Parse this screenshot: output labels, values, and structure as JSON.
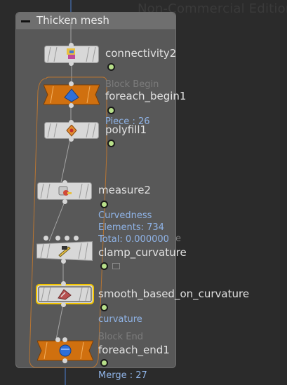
{
  "watermark": "Non-Commercial Edition",
  "network_box": {
    "title": "Thicken mesh"
  },
  "nodes": {
    "connectivity": {
      "name": "connectivity2"
    },
    "foreach_begin": {
      "name": "foreach_begin1",
      "ghost": "Block Begin",
      "info": "Piece : 26"
    },
    "polyfill": {
      "name": "polyfill1"
    },
    "measure": {
      "name": "measure2",
      "info": [
        "Curvedness",
        "Elements: 734",
        "Total: 0.000000"
      ]
    },
    "clamp": {
      "name": "clamp_curvature",
      "ghost": "e"
    },
    "smooth": {
      "name": "smooth_based_on_curvature",
      "info": "curvature"
    },
    "foreach_end": {
      "name": "foreach_end1",
      "ghost": "Block End",
      "info": "Merge : 27"
    }
  },
  "colors": {
    "background": "#2b2b2b",
    "network_box": "#585858",
    "info_text": "#8fb3e6",
    "foreach_node": "#d0700f",
    "selected_outline": "#f2c400",
    "display_flag": "#b8e08a"
  }
}
